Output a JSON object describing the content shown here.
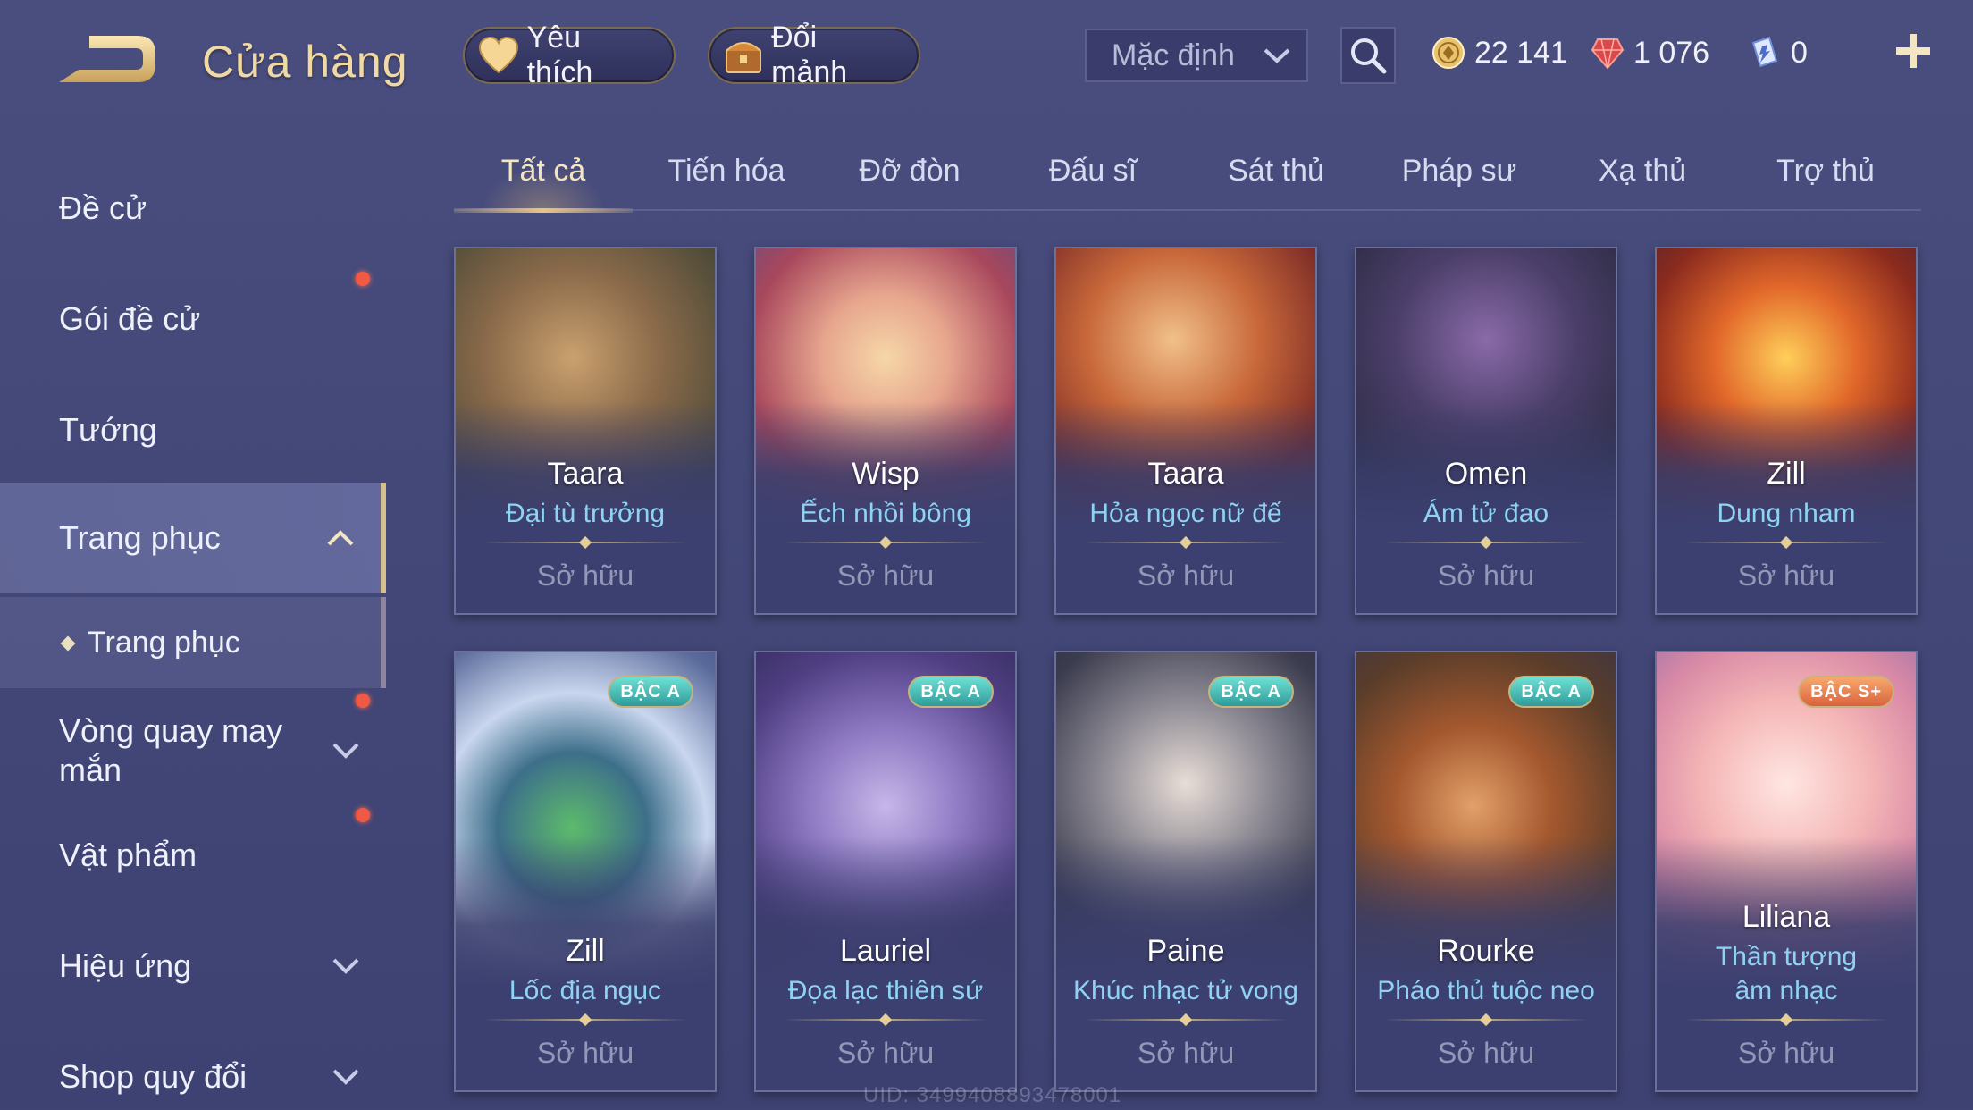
{
  "header": {
    "title": "Cửa hàng",
    "favorite_label": "Yêu thích",
    "exchange_label": "Đổi mảnh",
    "sort_value": "Mặc định",
    "currencies": [
      {
        "icon": "gold-coin-icon",
        "value": "22 141"
      },
      {
        "icon": "ruby-gem-icon",
        "value": "1 076"
      },
      {
        "icon": "voucher-icon",
        "value": "0"
      }
    ]
  },
  "sidebar": {
    "items": [
      {
        "label": "Đề cử"
      },
      {
        "label": "Gói đề cử"
      },
      {
        "label": "Tướng"
      },
      {
        "label": "Trang phục"
      },
      {
        "label": "Trang phục"
      },
      {
        "label": "Vòng quay may mắn"
      },
      {
        "label": "Vật phẩm"
      },
      {
        "label": "Hiệu ứng"
      },
      {
        "label": "Shop quy đổi"
      }
    ]
  },
  "tabs": [
    "Tất cả",
    "Tiến hóa",
    "Đỡ đòn",
    "Đấu sĩ",
    "Sát thủ",
    "Pháp sư",
    "Xạ thủ",
    "Trợ thủ"
  ],
  "cards": [
    {
      "hero": "Taara",
      "skin": "Đại tù trưởng",
      "status": "Sở hữu",
      "badge": ""
    },
    {
      "hero": "Wisp",
      "skin": "Ếch nhồi bông",
      "status": "Sở hữu",
      "badge": ""
    },
    {
      "hero": "Taara",
      "skin": "Hỏa ngọc nữ đế",
      "status": "Sở hữu",
      "badge": ""
    },
    {
      "hero": "Omen",
      "skin": "Ám tử đao",
      "status": "Sở hữu",
      "badge": ""
    },
    {
      "hero": "Zill",
      "skin": "Dung nham",
      "status": "Sở hữu",
      "badge": ""
    },
    {
      "hero": "Zill",
      "skin": "Lốc địa ngục",
      "status": "Sở hữu",
      "badge": "BẬC A"
    },
    {
      "hero": "Lauriel",
      "skin": "Đọa lạc thiên sứ",
      "status": "Sở hữu",
      "badge": "BẬC A"
    },
    {
      "hero": "Paine",
      "skin": "Khúc nhạc tử vong",
      "status": "Sở hữu",
      "badge": "BẬC A"
    },
    {
      "hero": "Rourke",
      "skin": "Pháo thủ tuộc neo",
      "status": "Sở hữu",
      "badge": "BẬC A"
    },
    {
      "hero": "Liliana",
      "skin": "Thần tượng âm nhạc",
      "status": "Sở hữu",
      "badge": "BẬC S+"
    }
  ],
  "footer": {
    "uid": "UID: 3499408893478001"
  },
  "colors": {
    "background": "#444878",
    "title_gold": "#f1d9a4",
    "skin_name_blue": "#8fd3f4",
    "notification_red": "#f05a45",
    "badge_a": "#3fb3ad",
    "badge_s_plus": "#e57848"
  }
}
